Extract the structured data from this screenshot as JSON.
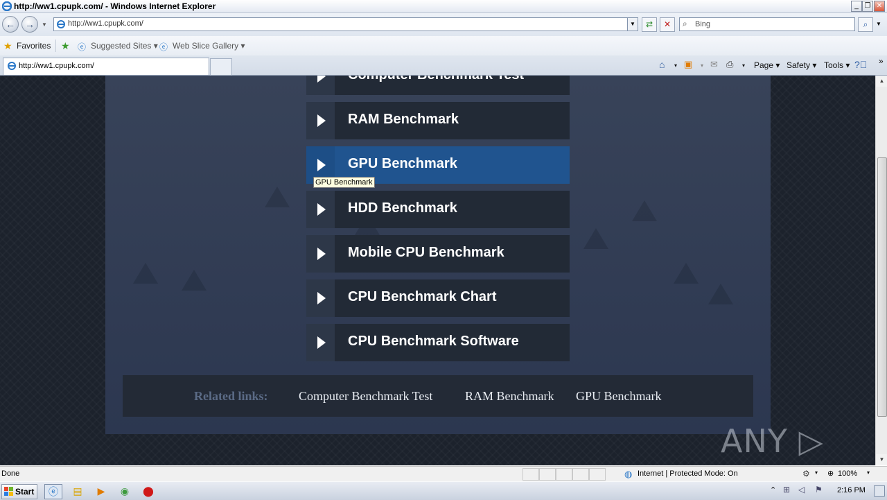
{
  "window": {
    "title": "http://ww1.cpupk.com/ - Windows Internet Explorer",
    "controls": {
      "minimize": "_",
      "restore": "❐",
      "close": "✕"
    }
  },
  "address_bar": {
    "url": "http://ww1.cpupk.com/",
    "search_placeholder": "Bing"
  },
  "favorites_bar": {
    "favorites_label": "Favorites",
    "items": [
      {
        "label": "Suggested Sites ▾"
      },
      {
        "label": "Web Slice Gallery ▾"
      }
    ]
  },
  "tab": {
    "label": "http://ww1.cpupk.com/"
  },
  "command_bar": {
    "page": "Page ▾",
    "safety": "Safety ▾",
    "tools": "Tools ▾"
  },
  "page": {
    "menu": [
      {
        "label": "Computer Benchmark Test",
        "active": false
      },
      {
        "label": "RAM Benchmark",
        "active": false
      },
      {
        "label": "GPU Benchmark",
        "active": true
      },
      {
        "label": "HDD Benchmark",
        "active": false
      },
      {
        "label": "Mobile CPU Benchmark",
        "active": false
      },
      {
        "label": "CPU Benchmark Chart",
        "active": false
      },
      {
        "label": "CPU Benchmark Software",
        "active": false
      }
    ],
    "tooltip": "GPU Benchmark",
    "related": {
      "title": "Related links:",
      "links": [
        "Computer Benchmark Test",
        "RAM Benchmark",
        "GPU Benchmark"
      ]
    },
    "watermark": "ANY ▷ RUN"
  },
  "status_bar": {
    "status": "Done",
    "zone": "Internet | Protected Mode: On",
    "zoom": "100%"
  },
  "taskbar": {
    "start_label": "Start",
    "time": "2:16 PM"
  },
  "colors": {
    "accent_active": "#20548f",
    "menu_bg": "#222a36",
    "page_bg": "#1c222c"
  }
}
